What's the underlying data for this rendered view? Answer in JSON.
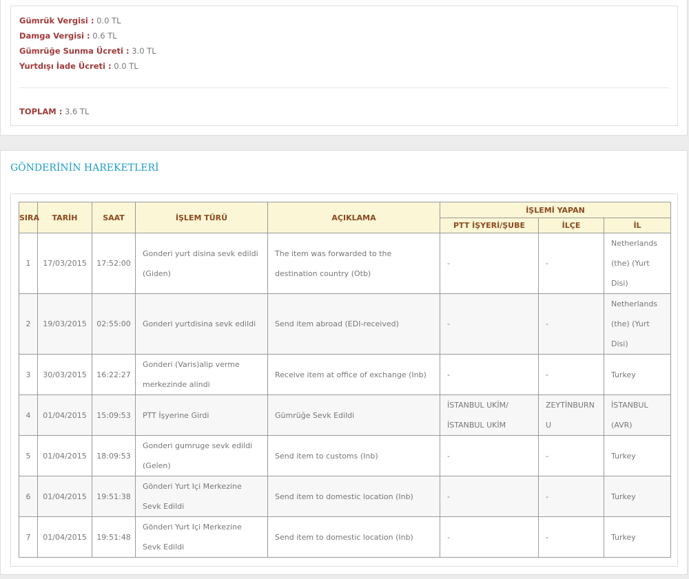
{
  "fees": [
    {
      "label": "Gümrük Vergisi :",
      "value": "0.0 TL"
    },
    {
      "label": "Damga Vergisi :",
      "value": "0.6 TL"
    },
    {
      "label": "Gümrüğe Sunma Ücreti :",
      "value": "3.0 TL"
    },
    {
      "label": "Yurtdışı İade Ücreti :",
      "value": "0.0 TL"
    }
  ],
  "total": {
    "label": "TOPLAM :",
    "value": "3.6 TL"
  },
  "movements": {
    "title": "GÖNDERİNİN HAREKETLERİ",
    "headers": {
      "sira": "SIRA",
      "tarih": "TARİH",
      "saat": "SAAT",
      "islem_turu": "İŞLEM TÜRÜ",
      "aciklama": "AÇIKLAMA",
      "islemi_yapan": "İŞLEMİ YAPAN",
      "ptt_isyeri": "PTT İŞYERİ/ŞUBE",
      "ilce": "İLÇE",
      "il": "İL"
    },
    "rows": [
      {
        "sira": "1",
        "tarih": "17/03/2015",
        "saat": "17:52:00",
        "islem": "Gonderi yurt disina sevk edildi (Giden)",
        "aciklama": "The item was forwarded to the destination country (Otb)",
        "ptt": "-",
        "ilce": "-",
        "il": "Netherlands (the) (Yurt Disi)"
      },
      {
        "sira": "2",
        "tarih": "19/03/2015",
        "saat": "02:55:00",
        "islem": "Gonderi yurtdisina sevk edildi",
        "aciklama": "Send item abroad (EDI-received)",
        "ptt": "-",
        "ilce": "-",
        "il": "Netherlands (the) (Yurt Disi)"
      },
      {
        "sira": "3",
        "tarih": "30/03/2015",
        "saat": "16:22:27",
        "islem": "Gonderi (Varis)alip verme merkezinde alindi",
        "aciklama": "Receive item at office of exchange (Inb)",
        "ptt": "-",
        "ilce": "-",
        "il": "Turkey"
      },
      {
        "sira": "4",
        "tarih": "01/04/2015",
        "saat": "15:09:53",
        "islem": "PTT İşyerine Girdi",
        "aciklama": "Gümrüğe Sevk Edildi",
        "ptt": "İSTANBUL UKİM/İSTANBUL UKİM",
        "ilce": "ZEYTİNBURNU",
        "il": "İSTANBUL (AVR)"
      },
      {
        "sira": "5",
        "tarih": "01/04/2015",
        "saat": "18:09:53",
        "islem": "Gonderi gumruge sevk edildi (Gelen)",
        "aciklama": "Send item to customs (Inb)",
        "ptt": "-",
        "ilce": "-",
        "il": "Turkey"
      },
      {
        "sira": "6",
        "tarih": "01/04/2015",
        "saat": "19:51:38",
        "islem": "Gönderi Yurt Içi Merkezine Sevk Edildi",
        "aciklama": "Send item to domestic location (Inb)",
        "ptt": "-",
        "ilce": "-",
        "il": "Turkey"
      },
      {
        "sira": "7",
        "tarih": "01/04/2015",
        "saat": "19:51:48",
        "islem": "Gönderi Yurt Içi Merkezine Sevk Edildi",
        "aciklama": "Send item to domestic location (Inb)",
        "ptt": "-",
        "ilce": "-",
        "il": "Turkey"
      }
    ]
  }
}
